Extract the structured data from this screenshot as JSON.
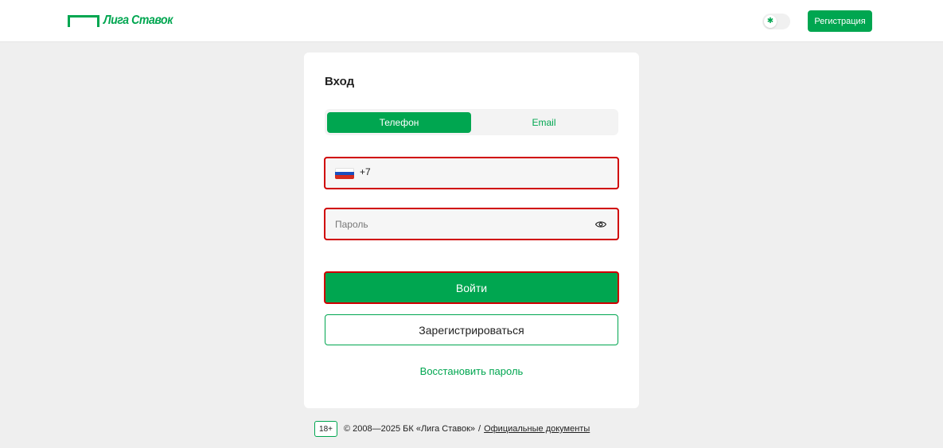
{
  "header": {
    "logo_text": "Лига Ставок",
    "register_label": "Регистрация",
    "theme_toggle_icon": "sun-icon"
  },
  "login": {
    "title": "Вход",
    "tabs": [
      {
        "label": "Телефон",
        "active": true
      },
      {
        "label": "Email",
        "active": false
      }
    ],
    "phone": {
      "country_flag": "russia-flag-icon",
      "prefix": "+7",
      "value": ""
    },
    "password": {
      "placeholder": "Пароль",
      "value": "",
      "toggle_icon": "eye-icon"
    },
    "submit_label": "Войти",
    "register_label": "Зарегистрироваться",
    "restore_label": "Восстановить пароль"
  },
  "footer": {
    "age_badge": "18+",
    "copyright": "© 2008—2025 БК «Лига Ставок»",
    "separator": "/",
    "docs_link": "Официальные документы"
  },
  "colors": {
    "brand": "#00a650",
    "error_border": "#d00000",
    "background": "#efefef"
  }
}
